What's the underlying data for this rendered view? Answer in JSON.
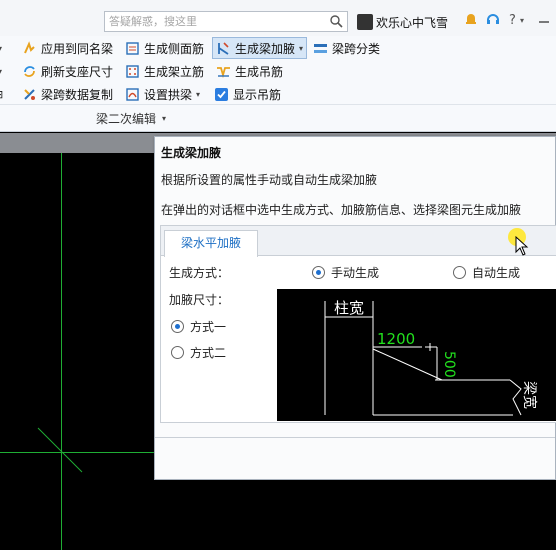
{
  "topbar": {
    "search_placeholder": "答疑解惑，搜这里",
    "username": "欢乐心中飞雪"
  },
  "ribbon": {
    "buttons": [
      {
        "label": "应用到同名梁"
      },
      {
        "label": "生成侧面筋"
      },
      {
        "label": "生成梁加腋"
      },
      {
        "label": "梁跨分类"
      },
      {
        "label": "刷新支座尺寸"
      },
      {
        "label": "生成架立筋"
      },
      {
        "label": "生成吊筋"
      },
      {
        "label": "梁跨数据复制"
      },
      {
        "label": "设置拱梁"
      },
      {
        "label": "显示吊筋"
      }
    ],
    "group_label": "梁二次编辑"
  },
  "tooltip": {
    "title": "生成梁加腋",
    "line1": "根据所设置的属性手动或自动生成梁加腋",
    "line2": "在弹出的对话框中选中生成方式、加腋筋信息、选择梁图元生成加腋",
    "tab": "梁水平加腋",
    "gen_mode_label": "生成方式：",
    "gen_manual": "手动生成",
    "gen_auto": "自动生成",
    "haunch_size_label": "加腋尺寸：",
    "mode1": "方式一",
    "mode2": "方式二",
    "cad_col_width": "柱宽",
    "cad_dim1": "1200",
    "cad_dim2": "500",
    "cad_beam_width": "梁宽"
  },
  "colors": {
    "accent": "#1e6fcf",
    "cad_green": "#1fae34",
    "cad_bg": "#000000"
  }
}
